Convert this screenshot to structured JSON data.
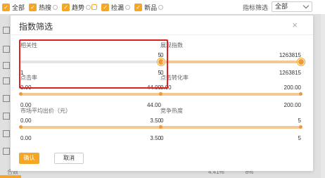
{
  "filter_bar": {
    "items": [
      {
        "label": "全部"
      },
      {
        "label": "热搜"
      },
      {
        "label": "趋势"
      },
      {
        "label": "捡漏"
      },
      {
        "label": "新品"
      }
    ],
    "index_filter_label": "指标筛选",
    "index_filter_value": "全部"
  },
  "modal": {
    "title": "指数筛选",
    "close": "×",
    "sliders": [
      {
        "label": "相关性",
        "top_right": "5",
        "bottom_left": "1",
        "bottom_right": "5",
        "min": 1,
        "max": 5,
        "lo": 5,
        "hi": 5
      },
      {
        "label": "展现指数",
        "top_left": "0",
        "top_right": "1263815",
        "bottom_left": "0",
        "bottom_right": "1263815",
        "min": 0,
        "max": 1263815,
        "lo": 0,
        "hi": 1263815
      },
      {
        "label": "点击率",
        "top_left": "0.00",
        "top_right": "44.00",
        "bottom_left": "0.00",
        "bottom_right": "44.00",
        "min": 0,
        "max": 44,
        "lo": 0,
        "hi": 44
      },
      {
        "label": "点击转化率",
        "top_left": "0.00",
        "top_right": "200.00",
        "bottom_left": "",
        "bottom_right": "200.00",
        "min": 0,
        "max": 200,
        "lo": 0,
        "hi": 200
      },
      {
        "label": "市场平均出价（元）",
        "top_left": "0.00",
        "top_right": "3.50",
        "bottom_left": "0.00",
        "bottom_right": "3.50",
        "min": 0,
        "max": 3.5,
        "lo": 0,
        "hi": 3.5
      },
      {
        "label": "竞争热度",
        "top_left": "0",
        "top_right": "5",
        "bottom_left": "0",
        "bottom_right": "5",
        "min": 0,
        "max": 5,
        "lo": 0,
        "hi": 5
      }
    ],
    "confirm_label": "确认",
    "cancel_label": "取消"
  },
  "background_row": {
    "cells": [
      "合数",
      "4.41%",
      "8%"
    ]
  },
  "colors": {
    "accent": "#f5a623",
    "highlight_border": "#e02020"
  }
}
